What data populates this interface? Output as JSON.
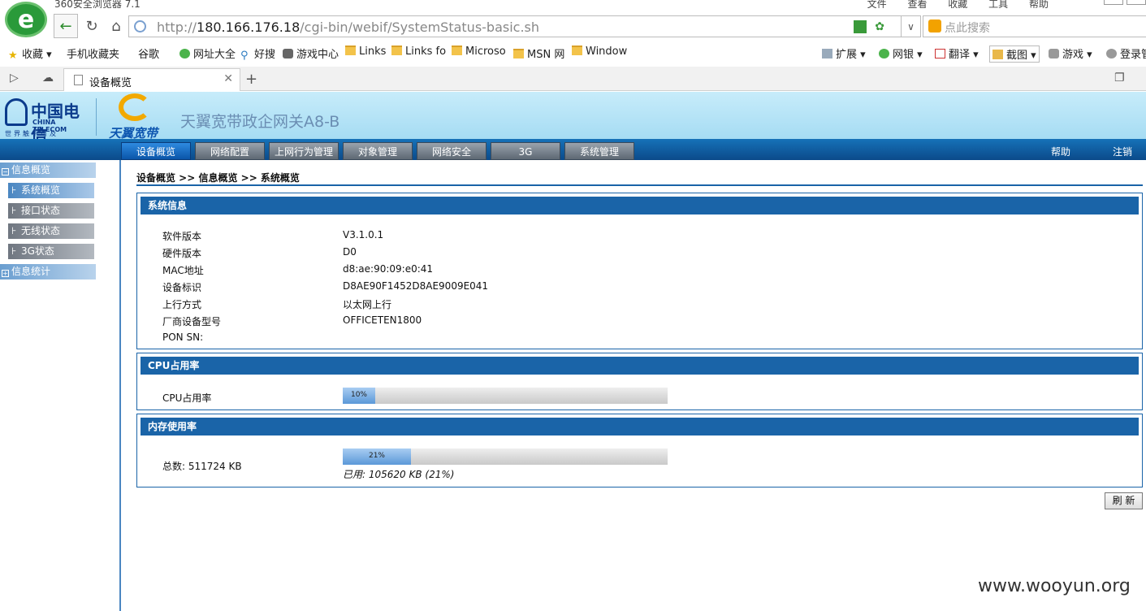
{
  "browser": {
    "app_title": "360安全浏览器 7.1",
    "menu": [
      "文件",
      "查看",
      "收藏",
      "工具",
      "帮助"
    ],
    "logo_letter": "e",
    "url_prefix": "http://",
    "url_host": "180.166.176.18",
    "url_path": "/cgi-bin/webif/SystemStatus-basic.sh",
    "search_placeholder": "点此搜索",
    "bookmarks": [
      {
        "label": "收藏",
        "icon": "star-icon"
      },
      {
        "label": "手机收藏夹",
        "icon": "phone-icon"
      },
      {
        "label": "谷歌",
        "icon": "page-icon"
      },
      {
        "label": "网址大全",
        "icon": "green-plus-icon"
      },
      {
        "label": "好搜",
        "icon": "search-icon"
      },
      {
        "label": "游戏中心",
        "icon": "gamepad-icon"
      },
      {
        "label": "Links",
        "icon": "folder-icon"
      },
      {
        "label": "Links fo",
        "icon": "folder-icon"
      },
      {
        "label": "Microso",
        "icon": "folder-icon"
      },
      {
        "label": "MSN 网",
        "icon": "folder-icon"
      },
      {
        "label": "Window",
        "icon": "folder-icon"
      }
    ],
    "toolbar_right": [
      "扩展",
      "网银",
      "翻译",
      "截图",
      "游戏",
      "登录管"
    ],
    "tab_title": "设备概览"
  },
  "router": {
    "brand_cn": "中国电信",
    "brand_en": "CHINA TELECOM",
    "slogan": "世界触手可及",
    "broadband_logo": "天翼宽带",
    "product_name": "天翼宽带政企网关A8-B",
    "nav_tabs": [
      "设备概览",
      "网络配置",
      "上网行为管理",
      "对象管理",
      "网络安全",
      "3G",
      "系统管理"
    ],
    "nav_links": [
      "帮助",
      "注销"
    ],
    "sidebar": [
      {
        "label": "信息概览",
        "level": "top",
        "prefix": "−"
      },
      {
        "label": "系统概览",
        "level": "sub",
        "prefix": "⊦",
        "active": true
      },
      {
        "label": "接口状态",
        "level": "sub",
        "prefix": "⊦"
      },
      {
        "label": "无线状态",
        "level": "sub",
        "prefix": "⊦"
      },
      {
        "label": "3G状态",
        "level": "sub",
        "prefix": "⊦"
      },
      {
        "label": "信息统计",
        "level": "top",
        "prefix": "+"
      }
    ],
    "breadcrumb": "设备概览 >> 信息概览 >> 系统概览",
    "sysinfo": {
      "title": "系统信息",
      "rows": [
        {
          "label": "软件版本",
          "value": "V3.1.0.1"
        },
        {
          "label": "硬件版本",
          "value": "D0"
        },
        {
          "label": "MAC地址",
          "value": "d8:ae:90:09:e0:41"
        },
        {
          "label": "设备标识",
          "value": "D8AE90F1452D8AE9009E041"
        },
        {
          "label": "上行方式",
          "value": "以太网上行"
        },
        {
          "label": "厂商设备型号",
          "value": "OFFICETEN1800"
        },
        {
          "label": "PON SN:",
          "value": ""
        }
      ]
    },
    "cpu": {
      "title": "CPU占用率",
      "label": "CPU占用率",
      "percent_text": "10%",
      "percent": 10
    },
    "memory": {
      "title": "内存使用率",
      "total_label": "总数: 511724 KB",
      "percent_text": "21%",
      "percent": 21,
      "used_text": "已用: 105620 KB (21%)"
    },
    "refresh_label": "刷 新"
  },
  "watermark": "www.wooyun.org"
}
